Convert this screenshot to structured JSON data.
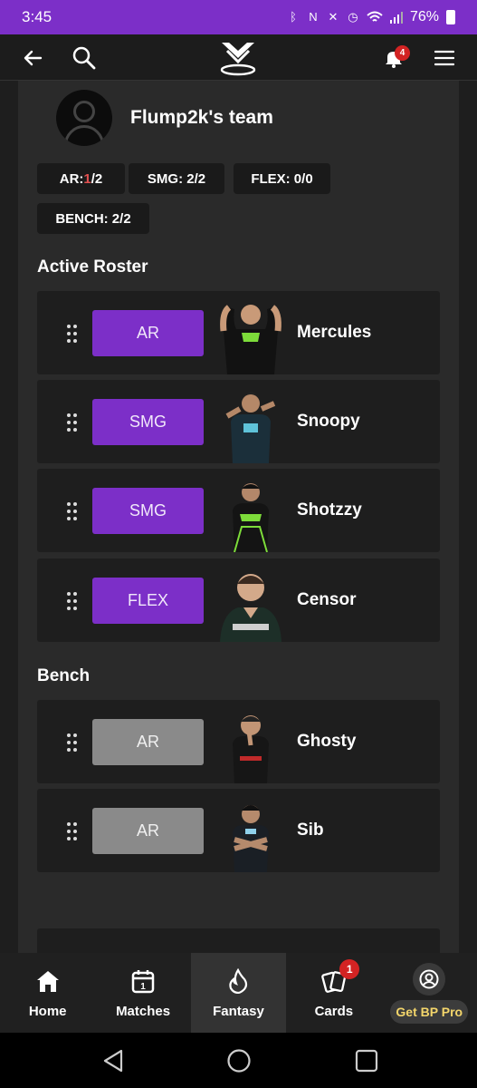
{
  "status_bar": {
    "time": "3:45",
    "battery": "76%"
  },
  "app_bar": {
    "notification_count": "4"
  },
  "team": {
    "name": "Flump2k's team"
  },
  "chips": {
    "ar_label": "AR: ",
    "ar_filled": "1",
    "ar_total": "/2",
    "smg": "SMG: 2/2",
    "flex": "FLEX: 0/0",
    "bench": "BENCH: 2/2"
  },
  "active_roster": {
    "title": "Active Roster",
    "players": [
      {
        "position": "AR",
        "name": "Mercules"
      },
      {
        "position": "SMG",
        "name": "Snoopy"
      },
      {
        "position": "SMG",
        "name": "Shotzzy"
      },
      {
        "position": "FLEX",
        "name": "Censor"
      }
    ]
  },
  "bench": {
    "title": "Bench",
    "players": [
      {
        "position": "AR",
        "name": "Ghosty"
      },
      {
        "position": "AR",
        "name": "Sib"
      }
    ]
  },
  "bottom_nav": {
    "items": [
      {
        "label": "Home",
        "icon": "home-icon"
      },
      {
        "label": "Matches",
        "icon": "calendar-icon"
      },
      {
        "label": "Fantasy",
        "icon": "flame-icon"
      },
      {
        "label": "Cards",
        "icon": "cards-icon",
        "badge": "1"
      },
      {
        "label": "Get BP Pro",
        "icon": "user-circle-icon"
      }
    ],
    "active": "Fantasy"
  },
  "colors": {
    "accent": "#7c2fc8",
    "bench_badge": "#8a8a8a",
    "pro_text": "#f4d66b",
    "badge_red": "#d32323"
  }
}
